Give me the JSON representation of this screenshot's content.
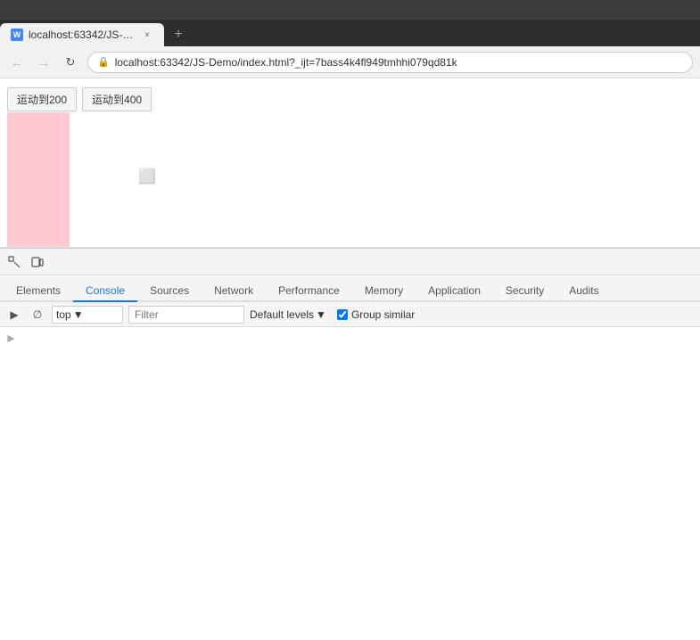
{
  "browser": {
    "title": "localhost:63342/JS-De...",
    "tab_close": "×",
    "url": "localhost:63342/JS-Demo/index.html?_ijt=7bass4k4fl949tmhhi079qd81k",
    "tab_icon_text": "W"
  },
  "page": {
    "button1": "运动到200",
    "button2": "运动到400"
  },
  "devtools": {
    "tabs": [
      {
        "label": "Elements",
        "active": false
      },
      {
        "label": "Console",
        "active": true
      },
      {
        "label": "Sources",
        "active": false
      },
      {
        "label": "Network",
        "active": false
      },
      {
        "label": "Performance",
        "active": false
      },
      {
        "label": "Memory",
        "active": false
      },
      {
        "label": "Application",
        "active": false
      },
      {
        "label": "Security",
        "active": false
      },
      {
        "label": "Audits",
        "active": false
      }
    ],
    "console_toolbar": {
      "top_label": "top",
      "filter_placeholder": "Filter",
      "default_levels": "Default levels",
      "group_similar": "Group similar"
    }
  }
}
